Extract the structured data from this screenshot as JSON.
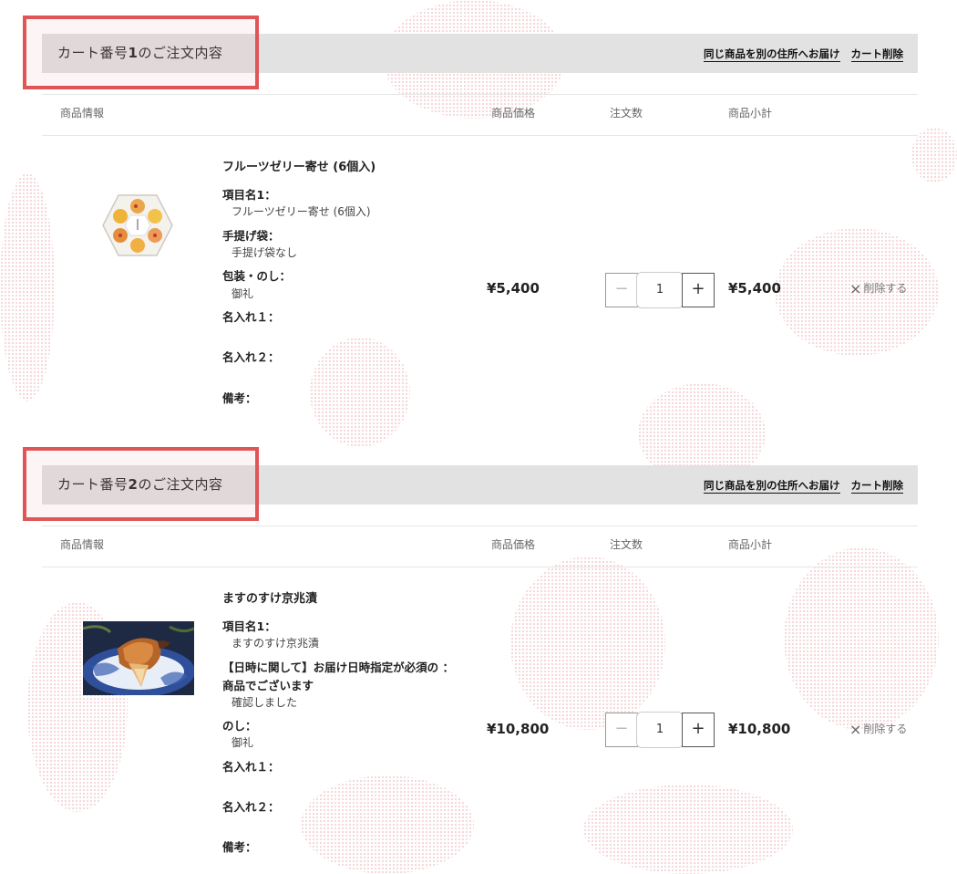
{
  "carts": [
    {
      "title_prefix": "カート番号",
      "number": "1",
      "title_suffix": "のご注文内容",
      "action_ship_other": "同じ商品を別の住所へお届け",
      "action_delete_cart": "カート削除",
      "columns": [
        "商品情報",
        "商品価格",
        "注文数",
        "商品小計"
      ],
      "item": {
        "name": "フルーツゼリー寄せ (6個入)",
        "options": [
          {
            "label": "項目名1：",
            "value": "フルーツゼリー寄せ (6個入)"
          },
          {
            "label": "手提げ袋：",
            "value": "手提げ袋なし"
          },
          {
            "label": "包装・のし：",
            "value": "御礼"
          },
          {
            "label": "名入れ１：",
            "value": ""
          },
          {
            "label": "名入れ２：",
            "value": ""
          },
          {
            "label": "備考：",
            "value": ""
          }
        ],
        "price": "¥5,400",
        "quantity": "1",
        "subtotal": "¥5,400",
        "delete_label": "削除する"
      }
    },
    {
      "title_prefix": "カート番号",
      "number": "2",
      "title_suffix": "のご注文内容",
      "action_ship_other": "同じ商品を別の住所へお届け",
      "action_delete_cart": "カート削除",
      "columns": [
        "商品情報",
        "商品価格",
        "注文数",
        "商品小計"
      ],
      "item": {
        "name": "ますのすけ京兆漬",
        "options": [
          {
            "label": "項目名1：",
            "value": "ますのすけ京兆漬"
          },
          {
            "label": "【日時に関して】お届け日時指定が必須の ：",
            "value": ""
          },
          {
            "label": "商品でございます",
            "value": "確認しました"
          },
          {
            "label": "のし：",
            "value": "御礼"
          },
          {
            "label": "名入れ１：",
            "value": ""
          },
          {
            "label": "名入れ２：",
            "value": ""
          },
          {
            "label": "備考：",
            "value": ""
          }
        ],
        "price": "¥10,800",
        "quantity": "1",
        "subtotal": "¥10,800",
        "delete_label": "削除する"
      }
    }
  ],
  "icons": {
    "minus": "−",
    "plus": "+",
    "close": "×"
  },
  "colors": {
    "header_bg": "#e2e2e2",
    "highlight": "#e05656",
    "background_pattern": "#f2c9cd"
  }
}
